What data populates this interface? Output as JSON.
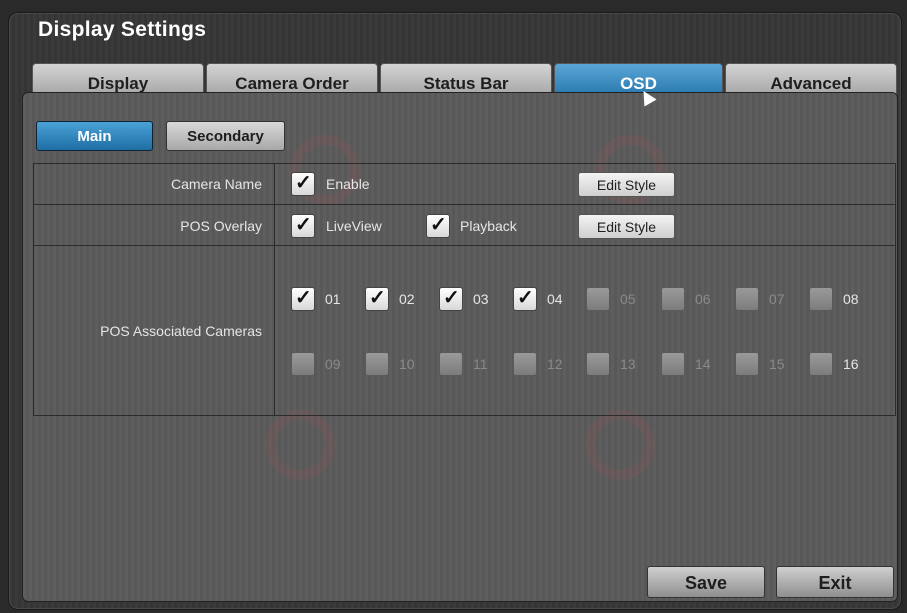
{
  "window": {
    "title": "Display Settings"
  },
  "tabs": [
    {
      "label": "Display"
    },
    {
      "label": "Camera Order"
    },
    {
      "label": "Status Bar"
    },
    {
      "label": "OSD"
    },
    {
      "label": "Advanced"
    }
  ],
  "active_tab": "OSD",
  "subtabs": {
    "main": "Main",
    "secondary": "Secondary",
    "active": "Main"
  },
  "rows": {
    "camera_name": {
      "label": "Camera Name",
      "enable": {
        "label": "Enable",
        "checked": true
      },
      "edit_style": "Edit Style"
    },
    "pos_overlay": {
      "label": "POS Overlay",
      "liveview": {
        "label": "LiveView",
        "checked": true
      },
      "playback": {
        "label": "Playback",
        "checked": true
      },
      "edit_style": "Edit Style"
    },
    "pos_cameras": {
      "label": "POS Associated Cameras",
      "cameras": [
        {
          "num": "01",
          "checked": true
        },
        {
          "num": "02",
          "checked": true
        },
        {
          "num": "03",
          "checked": true
        },
        {
          "num": "04",
          "checked": true
        },
        {
          "num": "05",
          "checked": false
        },
        {
          "num": "06",
          "checked": false
        },
        {
          "num": "07",
          "checked": false
        },
        {
          "num": "08",
          "checked": false
        },
        {
          "num": "09",
          "checked": false
        },
        {
          "num": "10",
          "checked": false
        },
        {
          "num": "11",
          "checked": false
        },
        {
          "num": "12",
          "checked": false
        },
        {
          "num": "13",
          "checked": false
        },
        {
          "num": "14",
          "checked": false
        },
        {
          "num": "15",
          "checked": false
        },
        {
          "num": "16",
          "checked": false
        }
      ]
    }
  },
  "footer": {
    "save": "Save",
    "exit": "Exit"
  },
  "colors": {
    "accent": "#2a7fba",
    "panel": "#5b5b5b"
  }
}
